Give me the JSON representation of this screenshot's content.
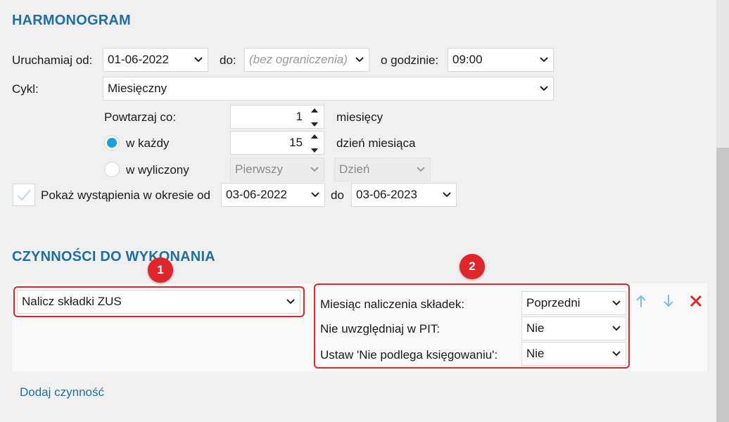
{
  "schedule": {
    "title": "HARMONOGRAM",
    "run_from_label": "Uruchamiaj od:",
    "run_from_value": "01-06-2022",
    "to_label": "do:",
    "to_value": "(bez ograniczenia)",
    "at_hour_label": "o godzinie:",
    "at_hour_value": "09:00",
    "cycle_label": "Cykl:",
    "cycle_value": "Miesięczny",
    "repeat_label": "Powtarzaj co:",
    "repeat_value": "1",
    "repeat_unit": "miesięcy",
    "each_label": "w każdy",
    "each_value": "15",
    "each_unit": "dzień miesiąca",
    "computed_label": "w wyliczony",
    "computed_which": "Pierwszy",
    "computed_day": "Dzień",
    "show_label": "Pokaż wystąpienia w okresie od",
    "show_from": "03-06-2022",
    "show_to_label": "do",
    "show_to": "03-06-2023"
  },
  "actions": {
    "title": "CZYNNOŚCI DO WYKONANIA",
    "action_value": "Nalicz składki ZUS",
    "params": [
      {
        "label": "Miesiąc naliczenia składek:",
        "value": "Poprzedni"
      },
      {
        "label": "Nie uwzględniaj w PIT:",
        "value": "Nie"
      },
      {
        "label": "Ustaw 'Nie podlega księgowaniu':",
        "value": "Nie"
      }
    ],
    "add_link": "Dodaj czynność"
  },
  "badges": {
    "one": "1",
    "two": "2"
  },
  "colors": {
    "accent": "#1d6fa5",
    "radio": "#16a2e0",
    "highlight": "#e0262b",
    "arrow": "#7cc0e6"
  }
}
